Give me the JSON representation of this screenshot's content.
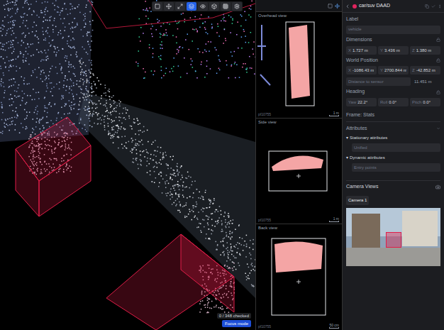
{
  "toolbar": {
    "tools": [
      {
        "selected": false
      },
      {
        "selected": false
      },
      {
        "selected": false
      },
      {
        "selected": true
      },
      {
        "selected": false
      },
      {
        "selected": false
      },
      {
        "selected": false
      },
      {
        "selected": false
      }
    ]
  },
  "viewport": {
    "status": "0 / 348 checked",
    "mode_button": "Focus mode"
  },
  "views": [
    {
      "title": "Overhead view",
      "frame": "pf10755",
      "scale": "1 m"
    },
    {
      "title": "Side view",
      "frame": "pf10755",
      "scale": "1 m"
    },
    {
      "title": "Back view",
      "frame": "pf10755",
      "scale": "50 cm"
    }
  ],
  "panel": {
    "title": "car/suv DAAD",
    "color": "#e0245e",
    "label": {
      "title": "Label",
      "value": "vehicle"
    },
    "dimensions": {
      "title": "Dimensions",
      "fields": [
        {
          "axis": "X",
          "value": "1.727 m"
        },
        {
          "axis": "Y",
          "value": "3.436 m"
        },
        {
          "axis": "Z",
          "value": "1.380 m"
        }
      ]
    },
    "world_position": {
      "title": "World Position",
      "fields": [
        {
          "axis": "X",
          "value": "-1086.43 m"
        },
        {
          "axis": "Y",
          "value": "2700.844 m"
        },
        {
          "axis": "Z",
          "value": "-42.852 m"
        }
      ],
      "distance_label": "Distance to sensor",
      "distance_value": "11.451 m"
    },
    "heading": {
      "title": "Heading",
      "fields": [
        {
          "axis": "Yaw",
          "value": "22.2°"
        },
        {
          "axis": "Roll",
          "value": "0.0°"
        },
        {
          "axis": "Pitch",
          "value": "0.0°"
        }
      ]
    },
    "frame": "Frame: Stats",
    "attributes": {
      "title": "Attributes",
      "groups": [
        {
          "toggle": "▾",
          "title": "Stationary attributes",
          "value": "Unified",
          "expanded": true
        },
        {
          "toggle": "▾",
          "title": "Dynamic attributes",
          "value": "Entry points",
          "expanded": true
        }
      ]
    },
    "camera": {
      "title": "Camera Views",
      "tabs": [
        {
          "label": "Camera 1",
          "selected": true
        }
      ]
    }
  }
}
